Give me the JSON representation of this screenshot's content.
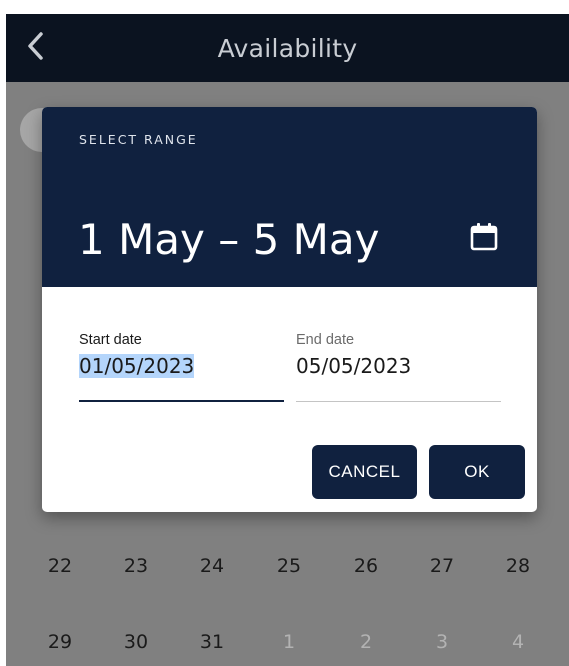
{
  "app_bar": {
    "title": "Availability",
    "back_icon": "chevron-left-icon"
  },
  "calendar": {
    "rows": [
      {
        "days": [
          "22",
          "23",
          "24",
          "25",
          "26",
          "27",
          "28"
        ],
        "muted": [
          false,
          false,
          false,
          false,
          false,
          false,
          false
        ]
      },
      {
        "days": [
          "29",
          "30",
          "31",
          "1",
          "2",
          "3",
          "4"
        ],
        "muted": [
          false,
          false,
          false,
          true,
          true,
          true,
          true
        ]
      }
    ]
  },
  "dialog": {
    "overline": "SELECT RANGE",
    "range_text": "1 May – 5 May",
    "calendar_icon": "calendar-icon",
    "start_field": {
      "label": "Start date",
      "value": "01/05/2023"
    },
    "end_field": {
      "label": "End date",
      "value": "05/05/2023"
    },
    "cancel_label": "CANCEL",
    "ok_label": "OK"
  },
  "colors": {
    "app_bar": "#0b1320",
    "dialog_header": "#10213f",
    "scrim": "#808080",
    "selection": "#b4d5fb"
  }
}
